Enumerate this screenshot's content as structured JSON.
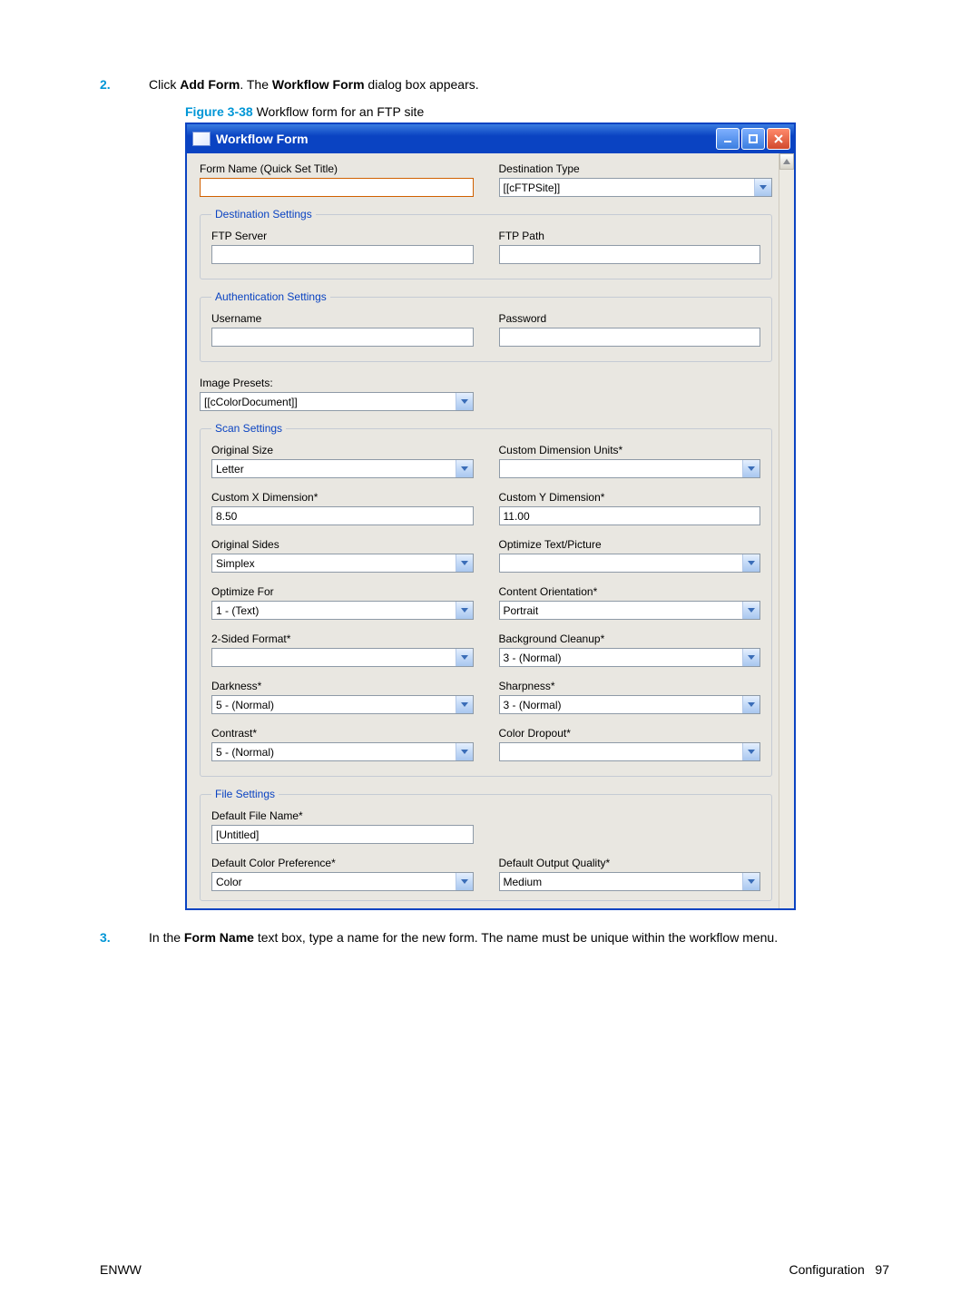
{
  "page": {
    "footer_left": "ENWW",
    "footer_section": "Configuration",
    "footer_page": "97"
  },
  "steps": {
    "s2": {
      "num": "2.",
      "pre": "Click ",
      "b1": "Add Form",
      "mid": ". The ",
      "b2": "Workflow Form",
      "post": " dialog box appears."
    },
    "s3": {
      "num": "3.",
      "pre": "In the ",
      "b1": "Form Name",
      "post": " text box, type a name for the new form. The name must be unique within the workflow menu."
    }
  },
  "figure": {
    "label": "Figure 3-38",
    "caption": "  Workflow form for an FTP site"
  },
  "dlg": {
    "title": "Workflow Form",
    "top": {
      "form_name_label": "Form Name (Quick Set Title)",
      "form_name_value": "",
      "dest_type_label": "Destination Type",
      "dest_type_value": "[[cFTPSite]]"
    },
    "dest": {
      "legend": "Destination Settings",
      "ftp_server_label": "FTP Server",
      "ftp_server_value": "",
      "ftp_path_label": "FTP Path",
      "ftp_path_value": ""
    },
    "auth": {
      "legend": "Authentication Settings",
      "user_label": "Username",
      "user_value": "",
      "pass_label": "Password",
      "pass_value": ""
    },
    "img_presets_label": "Image Presets:",
    "img_presets_value": "[[cColorDocument]]",
    "scan": {
      "legend": "Scan Settings",
      "orig_size_label": "Original Size",
      "orig_size_value": "Letter",
      "cdu_label": "Custom Dimension Units*",
      "cdu_value": "",
      "cx_label": "Custom X Dimension*",
      "cx_value": "8.50",
      "cy_label": "Custom Y Dimension*",
      "cy_value": "11.00",
      "orig_sides_label": "Original Sides",
      "orig_sides_value": "Simplex",
      "opt_tp_label": "Optimize Text/Picture",
      "opt_tp_value": "",
      "opt_for_label": "Optimize For",
      "opt_for_value": "1 - (Text)",
      "content_or_label": "Content Orientation*",
      "content_or_value": "Portrait",
      "two_sided_label": "2-Sided Format*",
      "two_sided_value": "",
      "bg_label": "Background Cleanup*",
      "bg_value": "3 - (Normal)",
      "dark_label": "Darkness*",
      "dark_value": "5 - (Normal)",
      "sharp_label": "Sharpness*",
      "sharp_value": "3 - (Normal)",
      "contrast_label": "Contrast*",
      "contrast_value": "5 - (Normal)",
      "dropout_label": "Color Dropout*",
      "dropout_value": ""
    },
    "file": {
      "legend": "File Settings",
      "fname_label": "Default File Name*",
      "fname_value": "[Untitled]",
      "cpref_label": "Default Color Preference*",
      "cpref_value": "Color",
      "oq_label": "Default Output Quality*",
      "oq_value": "Medium"
    }
  }
}
